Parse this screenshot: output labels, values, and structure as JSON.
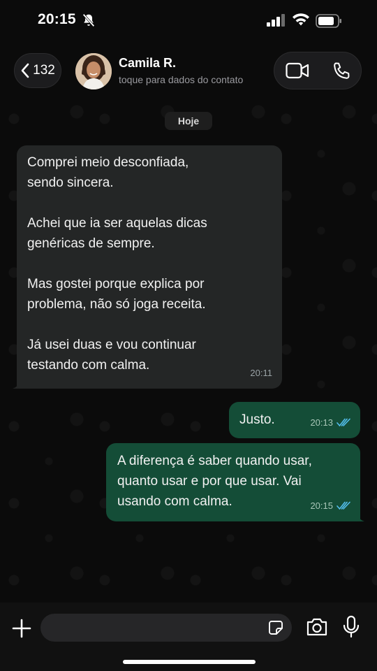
{
  "status_bar": {
    "time": "20:15"
  },
  "header": {
    "back_count": "132",
    "contact_name": "Camila R.",
    "contact_subtitle": "toque para dados do contato"
  },
  "chat": {
    "date_chip": "Hoje",
    "messages": [
      {
        "direction": "incoming",
        "paragraphs": [
          "Comprei meio desconfiada,\nsendo sincera.",
          "Achei que ia ser aquelas dicas\ngenéricas de sempre.",
          "Mas gostei porque explica por\nproblema, não só joga receita.",
          "Já usei duas e vou continuar\ntestando com calma."
        ],
        "time": "20:11"
      },
      {
        "direction": "outgoing",
        "text": "Justo.",
        "time": "20:13",
        "status": "read"
      },
      {
        "direction": "outgoing",
        "text": "A diferença é saber quando usar,\nquanto usar e por que usar. Vai\nusando com calma.",
        "time": "20:15",
        "status": "read"
      }
    ]
  },
  "composer": {
    "value": ""
  },
  "colors": {
    "incoming_bubble": "#242626",
    "outgoing_bubble": "#144d37",
    "read_tick": "#53bdeb"
  }
}
